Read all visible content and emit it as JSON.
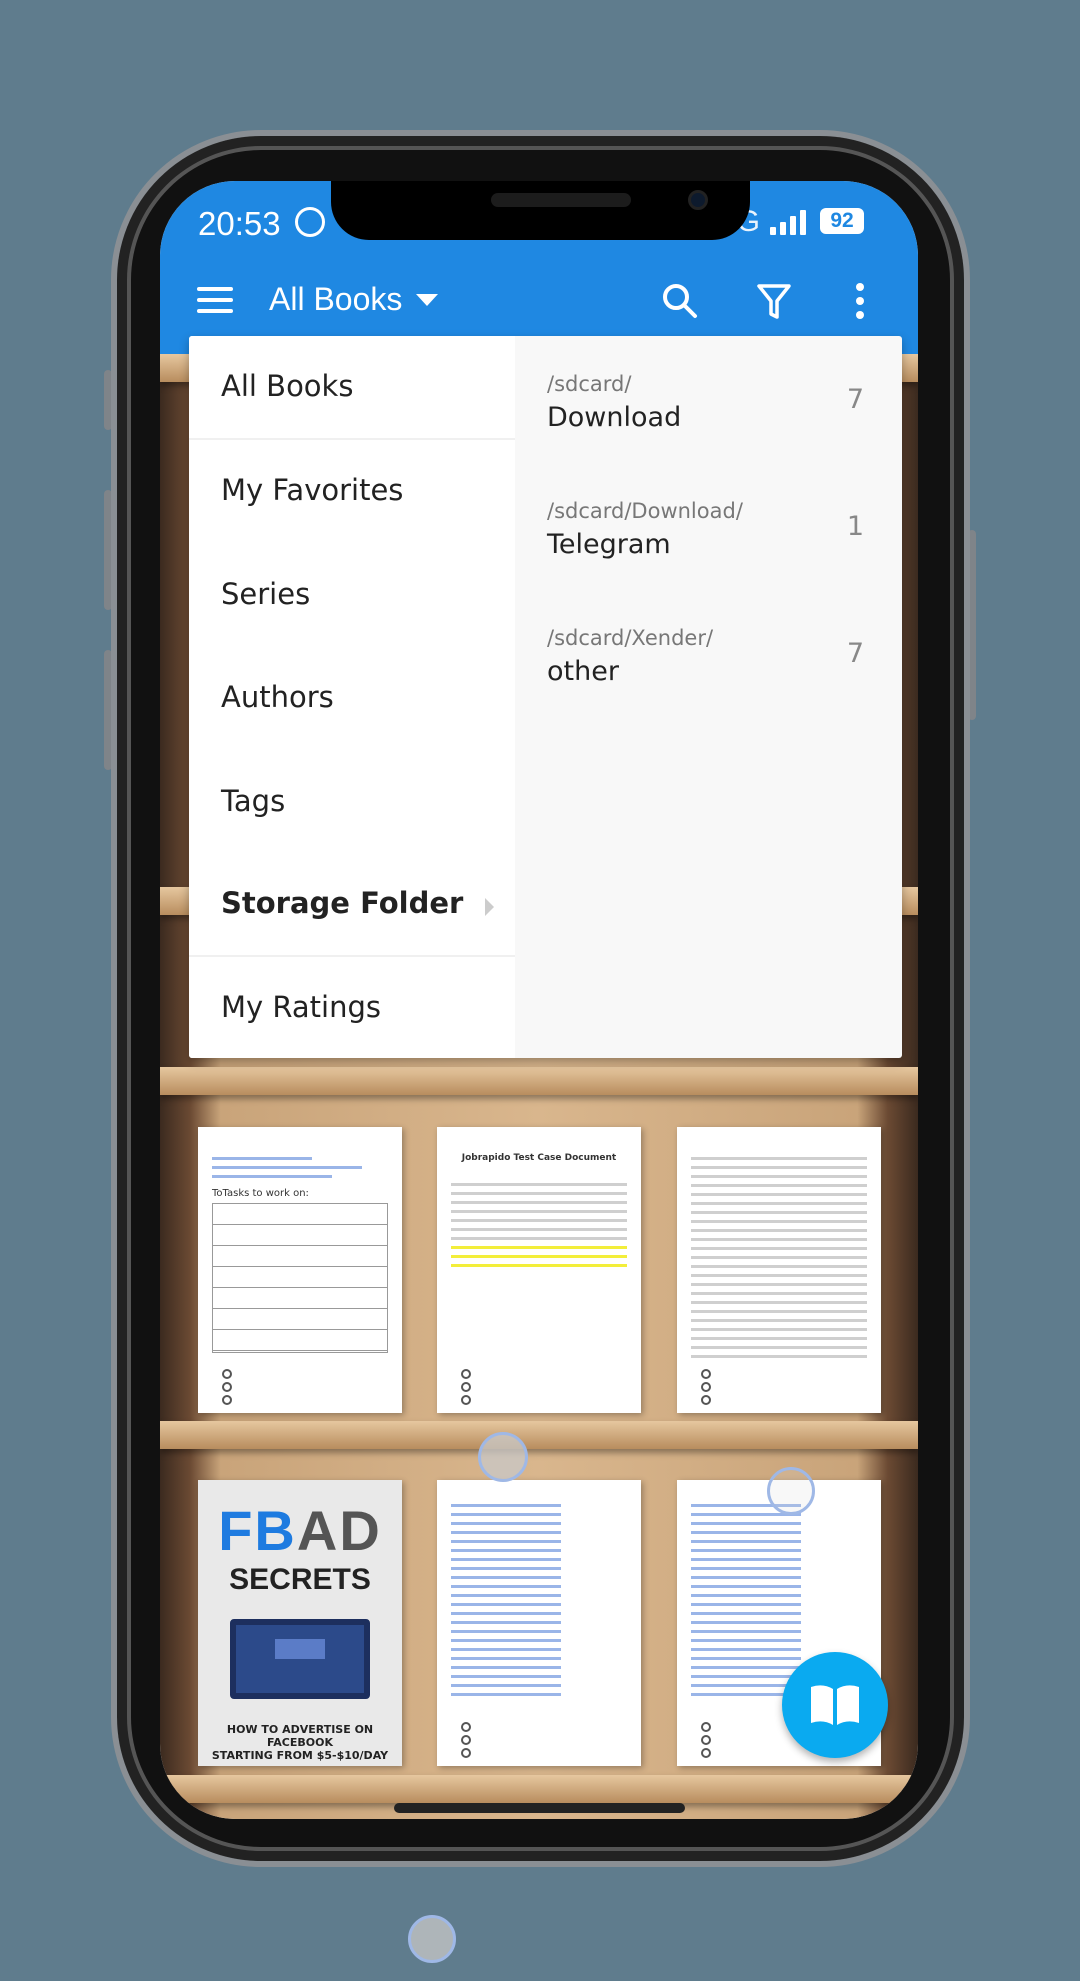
{
  "status_bar": {
    "time": "20:53",
    "network": "4G",
    "battery": "92"
  },
  "app_bar": {
    "title": "All Books",
    "icons": [
      "menu-icon",
      "search-icon",
      "filter-icon",
      "more-vert-icon"
    ]
  },
  "menu": {
    "items": [
      {
        "label": "All Books"
      },
      {
        "label": "My Favorites"
      },
      {
        "label": "Series"
      },
      {
        "label": "Authors"
      },
      {
        "label": "Tags"
      },
      {
        "label": "Storage Folder",
        "selected": true
      },
      {
        "label": "My Ratings"
      }
    ]
  },
  "folders": [
    {
      "path": "/sdcard/",
      "name": "Download",
      "count": "7"
    },
    {
      "path": "/sdcard/Download/",
      "name": "Telegram",
      "count": "1"
    },
    {
      "path": "/sdcard/Xender/",
      "name": "other",
      "count": "7"
    }
  ],
  "books": [
    {
      "heading": "ToTasks to work on:"
    },
    {
      "heading": "Jobrapido Test Case Document"
    },
    {
      "heading": ""
    },
    {
      "cover_line1_a": "FB",
      "cover_line1_b": "AD",
      "cover_line2": "SECRETS",
      "cover_sub1": "HOW TO ADVERTISE ON FACEBOOK",
      "cover_sub2": "STARTING FROM $5-$10/DAY"
    },
    {
      "heading": ""
    },
    {
      "heading": ""
    }
  ],
  "colors": {
    "accent": "#1f88e2",
    "fab": "#0aaaf0",
    "background": "#5f7c8d"
  }
}
